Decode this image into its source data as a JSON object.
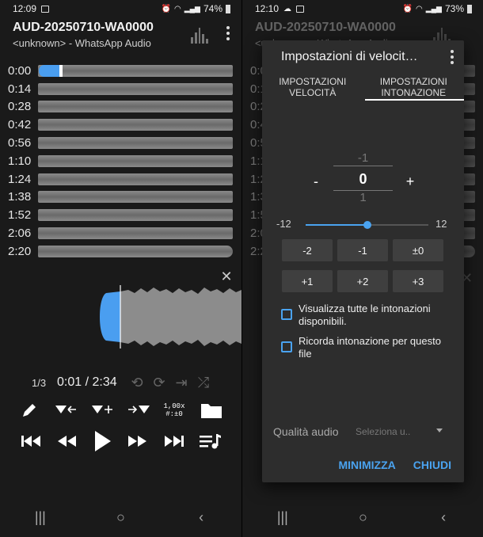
{
  "left": {
    "status": {
      "time": "12:09",
      "battery": "74%",
      "icons": [
        "image-icon",
        "alarm-icon",
        "wifi-icon",
        "4g-signal-icon",
        "battery-icon"
      ]
    },
    "title": "AUD-20250710-WA0000",
    "subtitle": "<unknown> - WhatsApp Audio",
    "timestamps": [
      "0:00",
      "0:14",
      "0:28",
      "0:42",
      "0:56",
      "1:10",
      "1:24",
      "1:38",
      "1:52",
      "2:06",
      "2:20"
    ],
    "close": "✕",
    "track_index": "1/3",
    "current_time": "0:01",
    "separator": "/",
    "total_time": "2:34",
    "speed_badge_line1": "1,00x",
    "speed_badge_line2": "#:±0",
    "playback_progress": 0.01
  },
  "right": {
    "status": {
      "time": "12:10",
      "battery": "73%"
    },
    "bg_title": "AUD-20250710-WA0000",
    "bg_subtitle": "<unknown> - WhatsApp Audio",
    "bg_timestamps": [
      "0:00",
      "0:14",
      "0:28",
      "0:42",
      "0:56",
      "1:10",
      "1:24",
      "1:38",
      "1:52",
      "2:06",
      "2:20"
    ],
    "dialog": {
      "title": "Impostazioni di velocit…",
      "tab_speed": "IMPOSTAZIONI VELOCITÀ",
      "tab_pitch": "IMPOSTAZIONI INTONAZIONE",
      "picker_prev": "-1",
      "picker_value": "0",
      "picker_next": "1",
      "minus": "-",
      "plus": "+",
      "slider_min": "-12",
      "slider_max": "12",
      "slider_value": 0,
      "pitch_buttons": [
        "-2",
        "-1",
        "±0",
        "+1",
        "+2",
        "+3"
      ],
      "check_show_all": "Visualizza tutte le intonazioni disponibili.",
      "check_remember": "Ricorda intonazione per questo file",
      "quality_label": "Qualità audio",
      "quality_placeholder": "Seleziona u..",
      "minimize": "MINIMIZZA",
      "close": "CHIUDI"
    }
  },
  "navbar": {
    "recents": "|||",
    "home": "○",
    "back": "‹"
  }
}
